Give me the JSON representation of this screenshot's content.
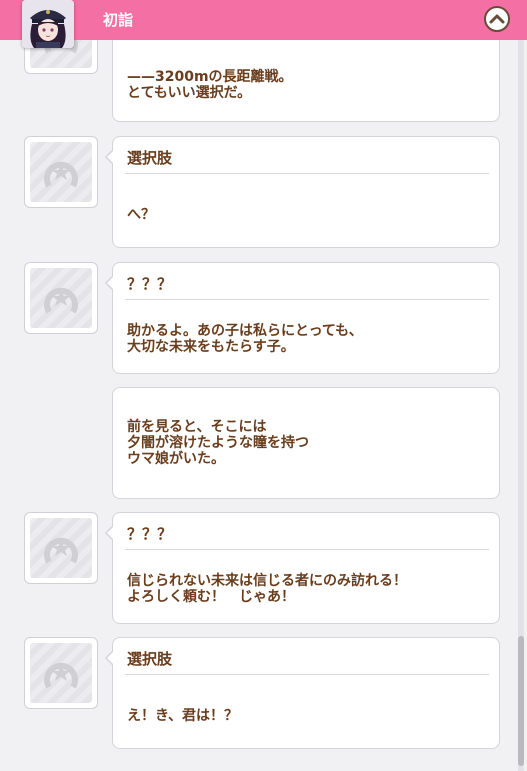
{
  "header": {
    "title": "初詣"
  },
  "entries": [
    {
      "speaker": "",
      "text": "——3200mの長距離戦。\nとてもいい選択だ。"
    },
    {
      "speaker": "選択肢",
      "text": "へ？"
    },
    {
      "speaker": "？？？",
      "text": "助かるよ。あの子は私らにとっても、\n大切な未来をもたらす子。"
    },
    {
      "speaker": "",
      "text": "前を見ると、そこには\n夕闇が溶けたような瞳を持つ\nウマ娘がいた。"
    },
    {
      "speaker": "？？？",
      "text": "信じられない未来は信じる者にのみ訪れる！\nよろしく頼む！　じゃあ！"
    },
    {
      "speaker": "選択肢",
      "text": "え！き、君は！？"
    }
  ]
}
